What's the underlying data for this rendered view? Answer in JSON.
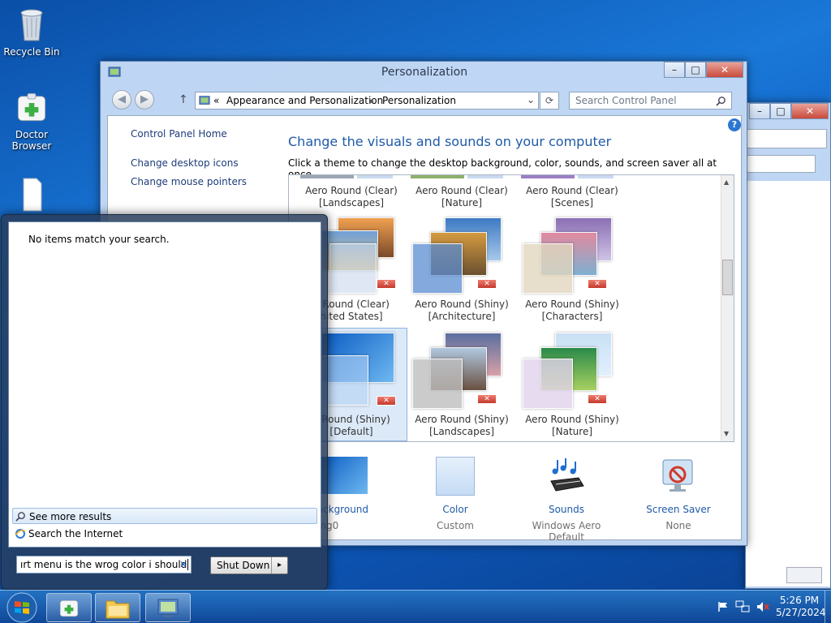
{
  "desktop": {
    "icons": [
      {
        "label": "Recycle Bin"
      },
      {
        "label": "Doctor Browser"
      },
      {
        "label": ""
      }
    ]
  },
  "window": {
    "title": "Personalization",
    "min": "–",
    "max": "□",
    "close": "✕",
    "address": {
      "prefix": "«",
      "crumb1": "Appearance and Personalization",
      "sep": "▸",
      "crumb2": "Personalization"
    },
    "search_placeholder": "Search Control Panel",
    "sidebar": {
      "home": "Control Panel Home",
      "links": [
        "Change desktop icons",
        "Change mouse pointers"
      ]
    },
    "heading": "Change the visuals and sounds on your computer",
    "subheading": "Click a theme to change the desktop background, color, sounds, and screen saver all at once.",
    "themes": [
      {
        "line1": "Aero Round (Clear)",
        "line2": "[Landscapes]"
      },
      {
        "line1": "Aero Round (Clear)",
        "line2": "[Nature]"
      },
      {
        "line1": "Aero Round (Clear)",
        "line2": "[Scenes]"
      },
      {
        "line1": "p Round (Clear)",
        "line2": "nited States]"
      },
      {
        "line1": "Aero Round (Shiny)",
        "line2": "[Architecture]"
      },
      {
        "line1": "Aero Round (Shiny)",
        "line2": "[Characters]"
      },
      {
        "line1": "o Round (Shiny)",
        "line2": "[Default]"
      },
      {
        "line1": "Aero Round (Shiny)",
        "line2": "[Landscapes]"
      },
      {
        "line1": "Aero Round (Shiny)",
        "line2": "[Nature]"
      }
    ],
    "bottom": [
      {
        "label": "p Background",
        "sub": "img0"
      },
      {
        "label": "Color",
        "sub": "Custom"
      },
      {
        "label": "Sounds",
        "sub": "Windows Aero Default"
      },
      {
        "label": "Screen Saver",
        "sub": "None"
      }
    ]
  },
  "start_menu": {
    "no_results": "No items match your search.",
    "see_more": "See more results",
    "search_internet": "Search the Internet",
    "search_value": "ırt menu is the wrog color i should",
    "clear": "✕",
    "shutdown": "Shut Down",
    "shutdown_arrow": "▸"
  },
  "taskbar": {
    "time": "5:26 PM",
    "date": "5/27/2024"
  }
}
